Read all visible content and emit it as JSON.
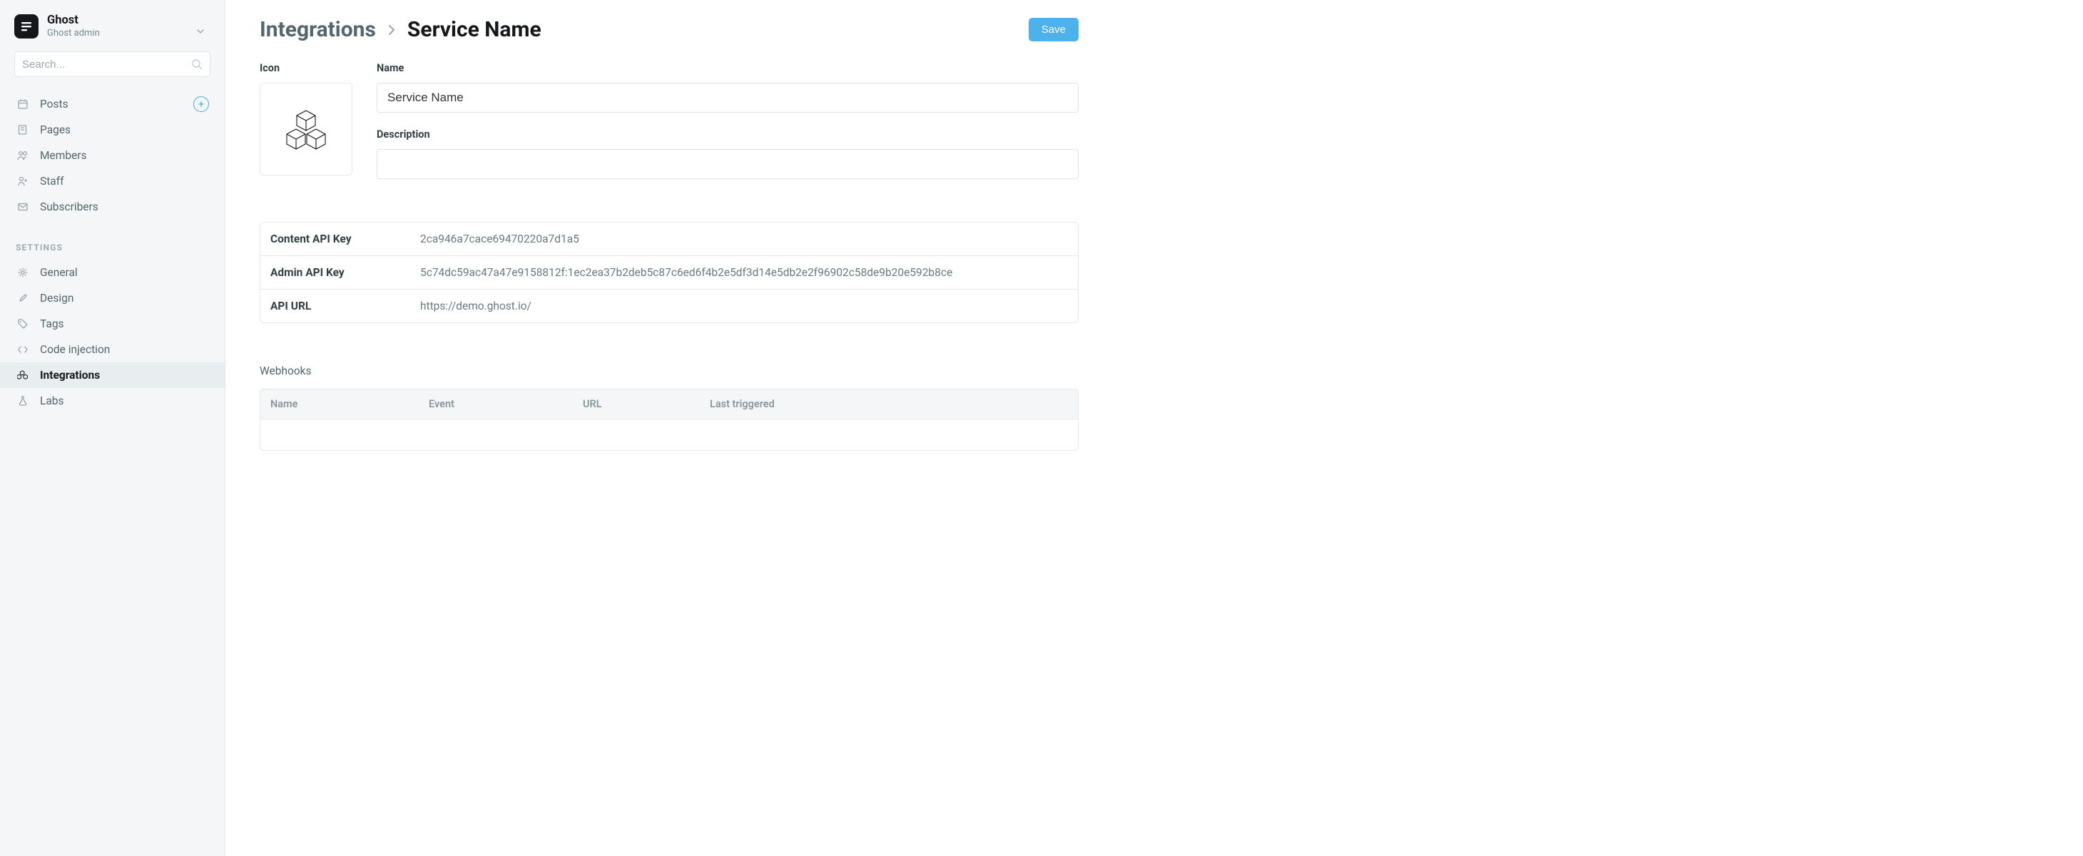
{
  "site": {
    "title": "Ghost",
    "subtitle": "Ghost admin"
  },
  "search": {
    "placeholder": "Search..."
  },
  "nav": {
    "primary": [
      {
        "label": "Posts",
        "has_plus": true
      },
      {
        "label": "Pages"
      },
      {
        "label": "Members"
      },
      {
        "label": "Staff"
      },
      {
        "label": "Subscribers"
      }
    ],
    "settings_label": "SETTINGS",
    "settings": [
      {
        "label": "General"
      },
      {
        "label": "Design"
      },
      {
        "label": "Tags"
      },
      {
        "label": "Code injection"
      },
      {
        "label": "Integrations",
        "active": true
      },
      {
        "label": "Labs"
      }
    ]
  },
  "header": {
    "root": "Integrations",
    "leaf": "Service Name",
    "save_label": "Save"
  },
  "form": {
    "icon_label": "Icon",
    "name_label": "Name",
    "name_value": "Service Name",
    "description_label": "Description",
    "description_value": ""
  },
  "api": {
    "rows": [
      {
        "label": "Content API Key",
        "value": "2ca946a7cace69470220a7d1a5"
      },
      {
        "label": "Admin API Key",
        "value": "5c74dc59ac47a47e9158812f:1ec2ea37b2deb5c87c6ed6f4b2e5df3d14e5db2e2f96902c58de9b20e592b8ce"
      },
      {
        "label": "API URL",
        "value": "https://demo.ghost.io/"
      }
    ]
  },
  "webhooks": {
    "title": "Webhooks",
    "columns": [
      "Name",
      "Event",
      "URL",
      "Last triggered"
    ]
  }
}
